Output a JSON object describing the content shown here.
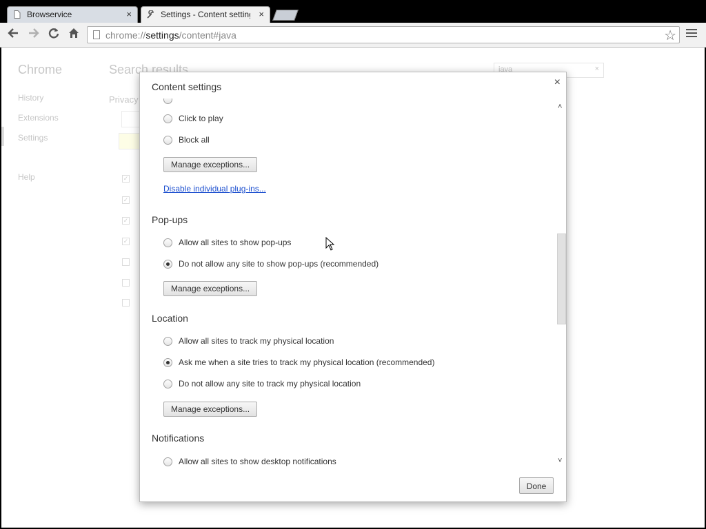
{
  "tabs": [
    {
      "title": "Browservice",
      "close": "×"
    },
    {
      "title": "Settings - Content settings",
      "close": "×"
    }
  ],
  "toolbar": {
    "url_scheme": "chrome://",
    "url_host": "settings",
    "url_path": "/content#java",
    "star": "☆"
  },
  "background": {
    "brand": "Chrome",
    "nav": [
      "History",
      "Extensions",
      "Settings",
      "Help"
    ],
    "search_title": "Search results",
    "section": "Privacy",
    "search_value": "java",
    "search_clear": "×"
  },
  "dialog": {
    "title": "Content settings",
    "close": "×",
    "plugins": {
      "options": [
        {
          "label": "Click to play",
          "checked": false
        },
        {
          "label": "Block all",
          "checked": false
        }
      ],
      "manage_label": "Manage exceptions...",
      "link": "Disable individual plug-ins..."
    },
    "popups": {
      "heading": "Pop-ups",
      "options": [
        {
          "label": "Allow all sites to show pop-ups",
          "checked": false
        },
        {
          "label": "Do not allow any site to show pop-ups (recommended)",
          "checked": true
        }
      ],
      "manage_label": "Manage exceptions..."
    },
    "location": {
      "heading": "Location",
      "options": [
        {
          "label": "Allow all sites to track my physical location",
          "checked": false
        },
        {
          "label": "Ask me when a site tries to track my physical location (recommended)",
          "checked": true
        },
        {
          "label": "Do not allow any site to track my physical location",
          "checked": false
        }
      ],
      "manage_label": "Manage exceptions..."
    },
    "notifications": {
      "heading": "Notifications",
      "options": [
        {
          "label": "Allow all sites to show desktop notifications",
          "checked": false
        }
      ]
    },
    "done_label": "Done"
  }
}
